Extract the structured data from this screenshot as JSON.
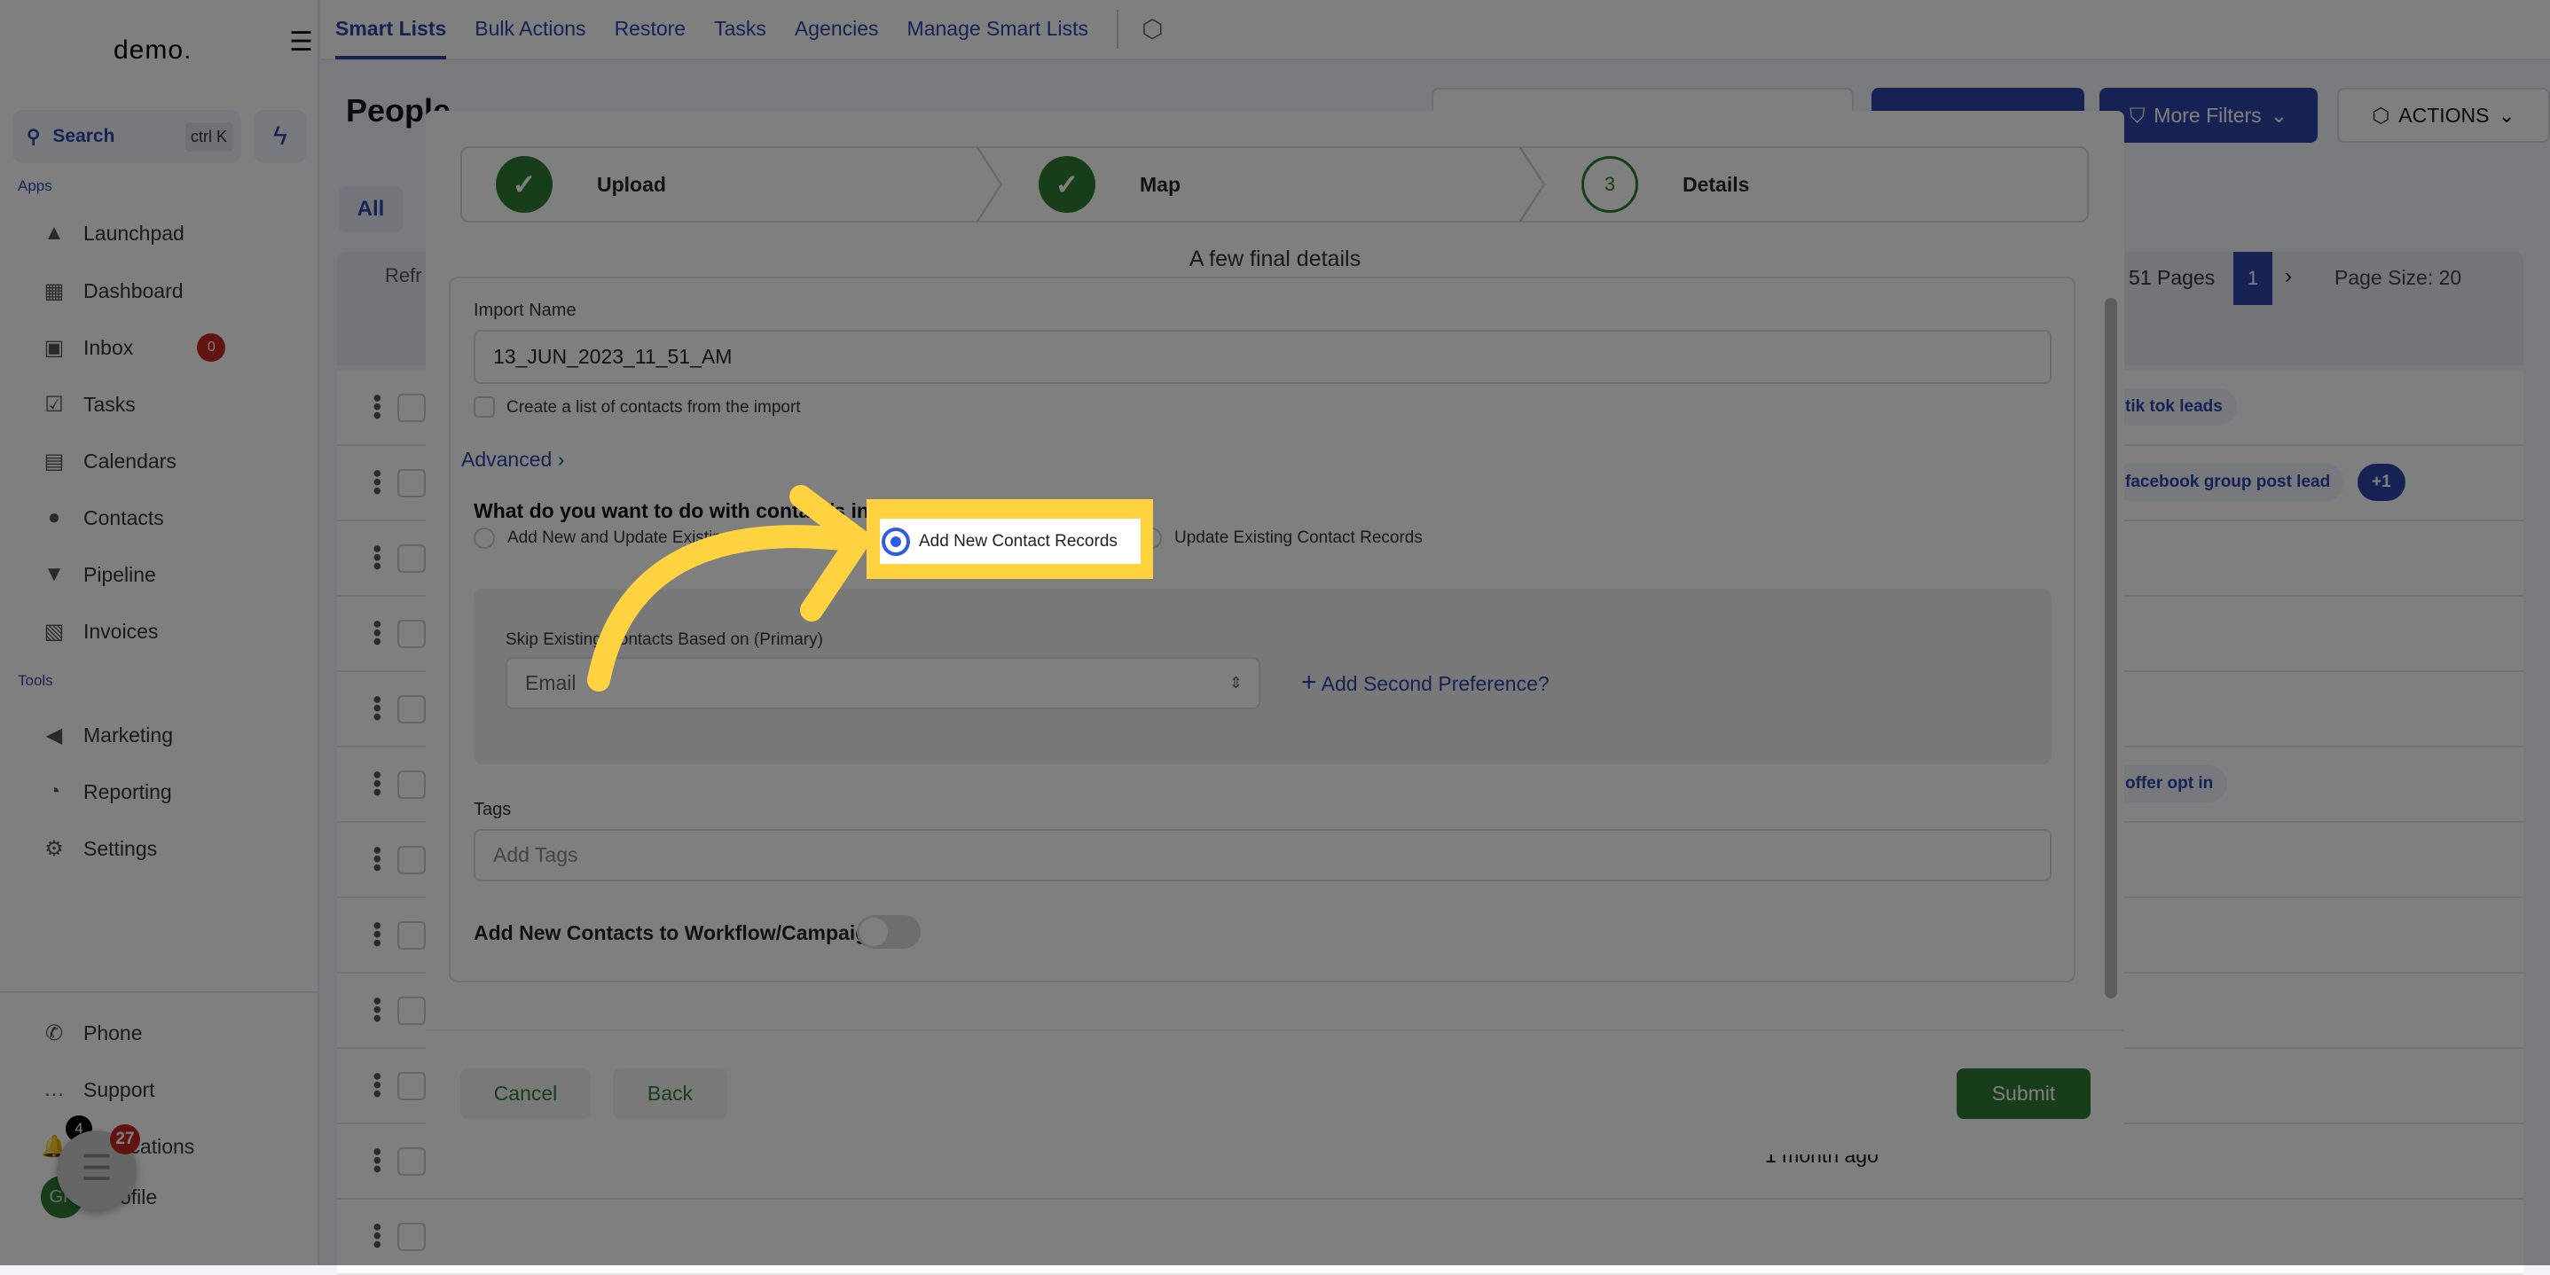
{
  "sidebar": {
    "logo": "demo.",
    "search": "Search",
    "shortcut": "ctrl K",
    "apps_label": "Apps",
    "tools_label": "Tools",
    "apps": [
      {
        "label": "Launchpad",
        "icon": "rocket-icon"
      },
      {
        "label": "Dashboard",
        "icon": "grid-icon"
      },
      {
        "label": "Inbox",
        "icon": "inbox-icon",
        "badge": "0"
      },
      {
        "label": "Tasks",
        "icon": "tasks-icon"
      },
      {
        "label": "Calendars",
        "icon": "calendar-icon"
      },
      {
        "label": "Contacts",
        "icon": "contacts-icon"
      },
      {
        "label": "Pipeline",
        "icon": "pipeline-icon"
      },
      {
        "label": "Invoices",
        "icon": "invoice-icon"
      }
    ],
    "tools": [
      {
        "label": "Marketing",
        "icon": "megaphone-icon"
      },
      {
        "label": "Reporting",
        "icon": "chart-icon"
      },
      {
        "label": "Settings",
        "icon": "gear-icon"
      }
    ],
    "bottom": [
      {
        "label": "Phone"
      },
      {
        "label": "Support"
      },
      {
        "label": "Notifications",
        "badge": "4"
      },
      {
        "label": "Profile",
        "avatar": "GP"
      }
    ],
    "chat_badge": "27"
  },
  "topnav": {
    "tabs": [
      "Smart Lists",
      "Bulk Actions",
      "Restore",
      "Tasks",
      "Agencies",
      "Manage Smart Lists"
    ],
    "active": "Smart Lists"
  },
  "page": {
    "title": "People",
    "more_filters": "More Filters",
    "actions": "ACTIONS",
    "all_tab": "All",
    "refresh": "Refr",
    "pages": "51 Pages",
    "current_page": "1",
    "page_size": "Page Size: 20",
    "tags": [
      {
        "row": 0,
        "label": "tik tok leads"
      },
      {
        "row": 1,
        "label": "facebook group post lead",
        "extra": "+1"
      },
      {
        "row": 5,
        "label": "offer opt in"
      }
    ],
    "last_row_time": "1 month ago"
  },
  "modal": {
    "steps": [
      {
        "label": "Upload",
        "status": "done"
      },
      {
        "label": "Map",
        "status": "done"
      },
      {
        "number": "3",
        "label": "Details",
        "status": "current"
      }
    ],
    "subtitle": "A few final details",
    "import_name_label": "Import Name",
    "import_name_value": "13_JUN_2023_11_51_AM",
    "create_list_label": "Create a list of contacts from the import",
    "advanced": "Advanced",
    "question": "What do you want to do with contact/s in the .csv file?",
    "options": [
      {
        "label": "Add New and Update Existing Contact Records",
        "selected": false
      },
      {
        "label": "Add New Contact Records",
        "selected": true
      },
      {
        "label": "Update Existing Contact Records",
        "selected": false
      }
    ],
    "skip_label": "Skip Existing Contacts Based on (Primary)",
    "skip_value": "Email",
    "add_second": "Add Second Preference?",
    "tags_label": "Tags",
    "tags_placeholder": "Add Tags",
    "workflow_label": "Add New Contacts to Workflow/Campaign",
    "workflow_on": false,
    "cancel": "Cancel",
    "back": "Back",
    "submit": "Submit"
  },
  "colors": {
    "accent": "#2c45a8",
    "success": "#2e7d32",
    "highlight": "#ffd23f",
    "radio": "#2f5be0"
  }
}
